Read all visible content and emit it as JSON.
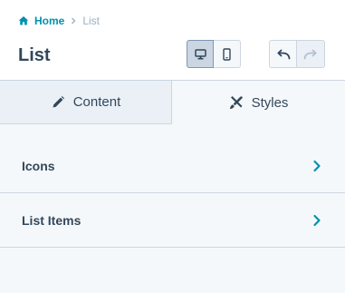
{
  "breadcrumb": {
    "home_label": "Home",
    "current_label": "List"
  },
  "header": {
    "title": "List"
  },
  "device_toggle": {
    "selected": "desktop",
    "options": [
      "desktop",
      "mobile"
    ]
  },
  "tabs": [
    {
      "label": "Content",
      "icon": "pencil-icon",
      "active": false
    },
    {
      "label": "Styles",
      "icon": "brush-ruler-icon",
      "active": true
    }
  ],
  "sections": [
    {
      "label": "Icons",
      "icon": "chevron-right-icon"
    },
    {
      "label": "List Items",
      "icon": "chevron-right-icon"
    }
  ],
  "colors": {
    "link": "#0091ae",
    "text": "#33475b",
    "muted": "#99afc4",
    "border": "#cbd6e2",
    "background": "#f5f8fa"
  }
}
